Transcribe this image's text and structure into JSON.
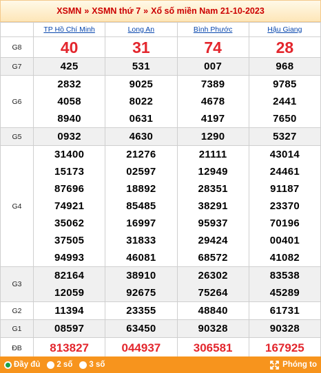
{
  "header": {
    "crumb1": "XSMN",
    "sep": "»",
    "crumb2": "XSMN thứ 7",
    "crumb3": "Xổ số miền Nam 21-10-2023"
  },
  "provinces": [
    "TP Hồ Chí Minh",
    "Long An",
    "Bình Phước",
    "Hậu Giang"
  ],
  "prizes": [
    {
      "label": "G8",
      "style": "big",
      "values": [
        [
          "40"
        ],
        [
          "31"
        ],
        [
          "74"
        ],
        [
          "28"
        ]
      ]
    },
    {
      "label": "G7",
      "style": "num",
      "values": [
        [
          "425"
        ],
        [
          "531"
        ],
        [
          "007"
        ],
        [
          "968"
        ]
      ]
    },
    {
      "label": "G6",
      "style": "num",
      "values": [
        [
          "2832",
          "4058",
          "8940"
        ],
        [
          "9025",
          "8022",
          "0631"
        ],
        [
          "7389",
          "4678",
          "4197"
        ],
        [
          "9785",
          "2441",
          "7650"
        ]
      ]
    },
    {
      "label": "G5",
      "style": "num",
      "values": [
        [
          "0932"
        ],
        [
          "4630"
        ],
        [
          "1290"
        ],
        [
          "5327"
        ]
      ]
    },
    {
      "label": "G4",
      "style": "num",
      "values": [
        [
          "31400",
          "15173",
          "87696",
          "74921",
          "35062",
          "37505",
          "94993"
        ],
        [
          "21276",
          "02597",
          "18892",
          "85485",
          "16997",
          "31833",
          "46081"
        ],
        [
          "21111",
          "12949",
          "28351",
          "38291",
          "95937",
          "29424",
          "68572"
        ],
        [
          "43014",
          "24461",
          "91187",
          "23370",
          "70196",
          "00401",
          "41082"
        ]
      ]
    },
    {
      "label": "G3",
      "style": "num",
      "values": [
        [
          "82164",
          "12059"
        ],
        [
          "38910",
          "92675"
        ],
        [
          "26302",
          "75264"
        ],
        [
          "83538",
          "45289"
        ]
      ]
    },
    {
      "label": "G2",
      "style": "num",
      "values": [
        [
          "11394"
        ],
        [
          "23355"
        ],
        [
          "48840"
        ],
        [
          "61731"
        ]
      ]
    },
    {
      "label": "G1",
      "style": "num",
      "values": [
        [
          "08597"
        ],
        [
          "63450"
        ],
        [
          "90328"
        ],
        [
          "90328"
        ]
      ]
    },
    {
      "label": "ĐB",
      "style": "db",
      "values": [
        [
          "813827"
        ],
        [
          "044937"
        ],
        [
          "306581"
        ],
        [
          "167925"
        ]
      ]
    }
  ],
  "footer": {
    "options": [
      "Đầy đủ",
      "2 số",
      "3 số"
    ],
    "selected": 0,
    "zoom_label": "Phóng to"
  },
  "colors": {
    "accent": "#f7941d",
    "prize_red": "#e3262d",
    "link": "#0645ad"
  }
}
